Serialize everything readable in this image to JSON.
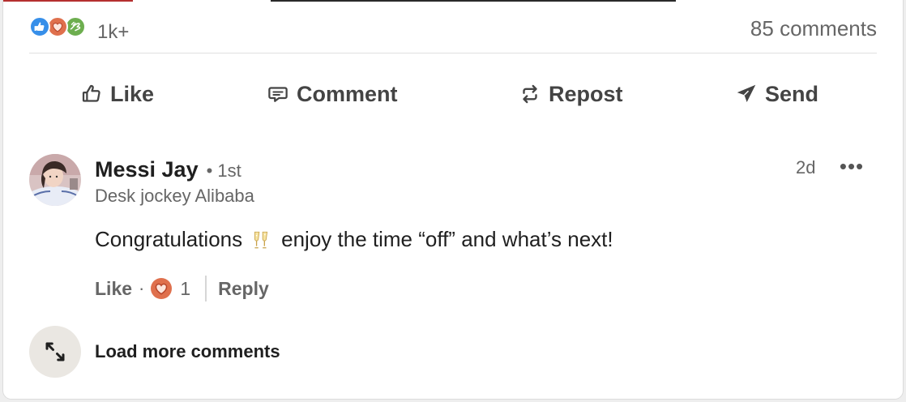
{
  "social": {
    "reactions": [
      "like-icon",
      "love-icon",
      "support-icon"
    ],
    "reaction_count": "1k+",
    "comments_count": "85 comments"
  },
  "actions": {
    "like": "Like",
    "comment": "Comment",
    "repost": "Repost",
    "send": "Send"
  },
  "comment": {
    "author": "Messi Jay",
    "degree": "• 1st",
    "headline": "Desk jockey Alibaba",
    "timestamp": "2d",
    "more": "•••",
    "text_before": "Congratulations",
    "emoji": "clinking-glasses-emoji",
    "text_after": "enjoy the time “off” and what’s next!",
    "like_label": "Like",
    "dot": "·",
    "reaction_count": "1",
    "reply_label": "Reply"
  },
  "load_more": {
    "label": "Load more comments"
  },
  "colors": {
    "like": "#378fe9",
    "love": "#df704d",
    "support": "#6dae4f",
    "text_muted": "#666666"
  }
}
